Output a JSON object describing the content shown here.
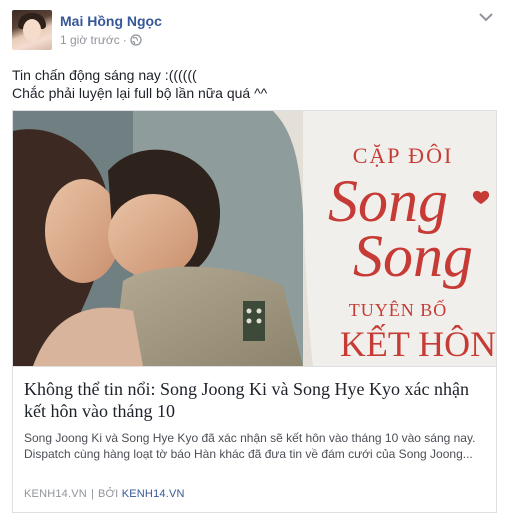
{
  "post": {
    "author": "Mai Hồng Ngọc",
    "timestamp": "1 giờ trước",
    "dot": "·",
    "privacy_icon": "globe-icon",
    "menu_icon": "chevron-down-icon",
    "text_lines": [
      "Tin chấn động sáng nay :((((((",
      "Chắc phải luyện lại full bộ lần nữa quá ^^"
    ]
  },
  "link_card": {
    "image": {
      "overlay_lines": [
        "CẶP ĐÔI",
        "Song",
        "Song",
        "TUYÊN BỐ",
        "KẾT HÔN"
      ]
    },
    "title": "Không thể tin nổi: Song Joong Ki và Song Hye Kyo xác nhận kết hôn vào tháng 10",
    "description_lines": [
      "Song Joong Ki và Song Hye Kyo đã xác nhận sẽ kết hôn vào tháng 10 vào sáng nay.",
      "Dispatch cùng hàng loạt tờ báo Hàn khác đã đưa tin về đám cưới của Song Joong..."
    ],
    "domain": "KENH14.VN",
    "separator": "|",
    "by_label": "BỞI",
    "by_source": "KENH14.VN"
  },
  "colors": {
    "author_link": "#365899",
    "meta_text": "#90949c",
    "overlay_red": "#c63b35",
    "border": "#dddfe2"
  }
}
